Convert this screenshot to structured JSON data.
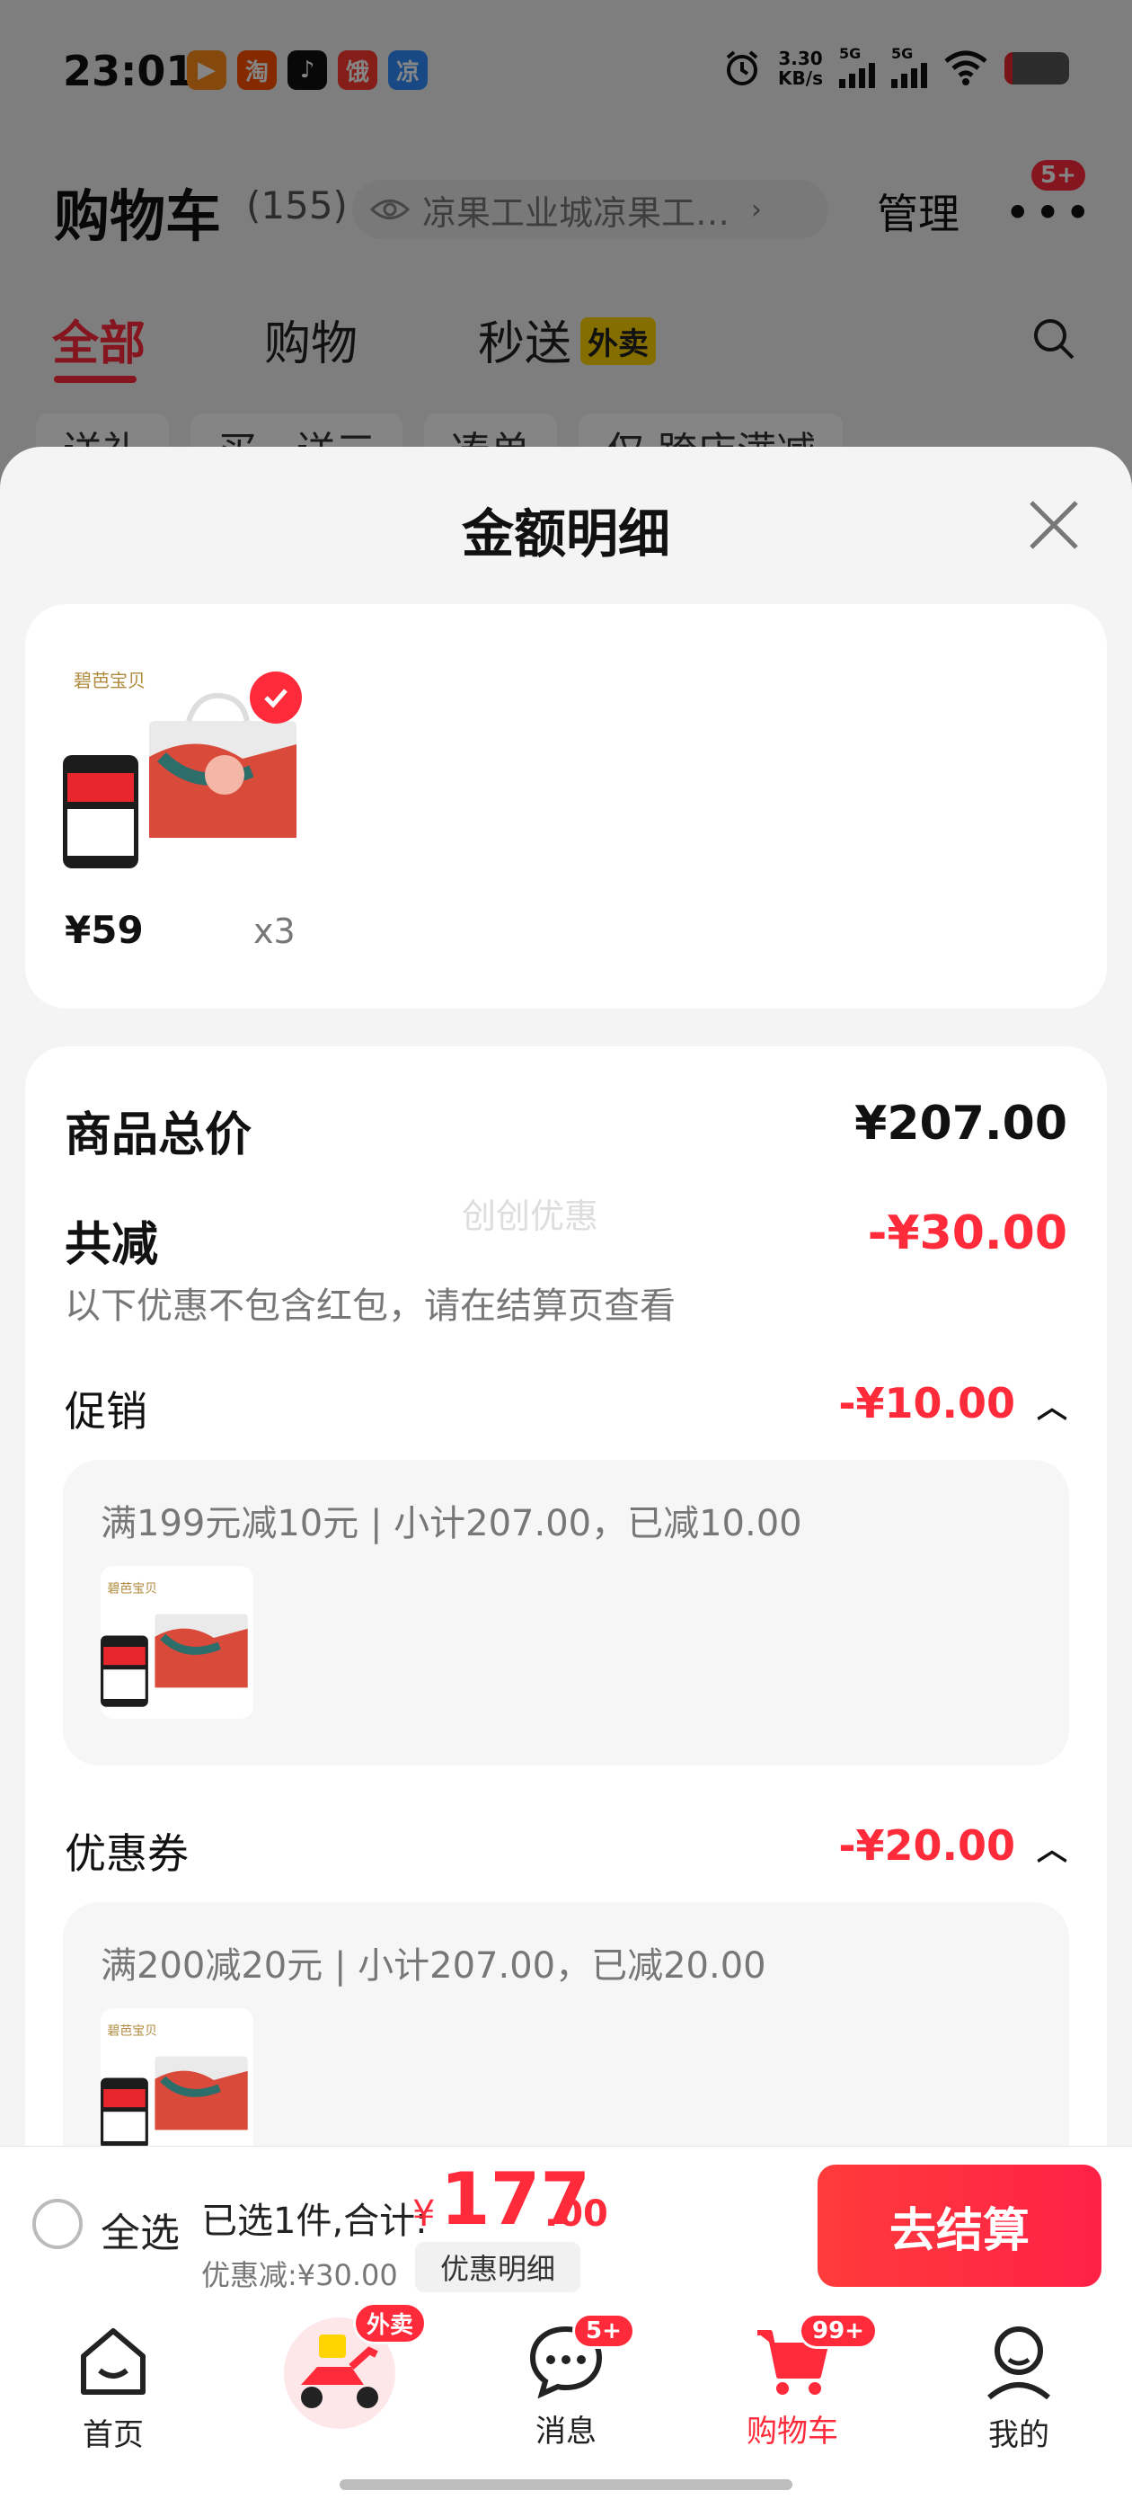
{
  "status_bar": {
    "time": "23:01",
    "apps": [
      {
        "glyph": "▶",
        "color": "#ff8c1a",
        "icon": "video-app-icon"
      },
      {
        "glyph": "淘",
        "color": "#ff5000",
        "icon": "taobao-app-icon"
      },
      {
        "glyph": "♪",
        "color": "#111111",
        "icon": "tiktok-app-icon"
      },
      {
        "glyph": "饿",
        "color": "#ff3b30",
        "icon": "eleme-app-icon"
      },
      {
        "glyph": "凉",
        "color": "#2f8cff",
        "icon": "liangguo-app-icon"
      }
    ],
    "net_speed_value": "3.30",
    "net_speed_unit": "KB/s",
    "network_1": "5G",
    "network_2": "5G",
    "battery_level": 0.12
  },
  "header": {
    "title": "购物车",
    "count": "(155)",
    "address": "凉果工业城凉果工…",
    "manage": "管理",
    "more_badge": "5+"
  },
  "tabs": [
    {
      "label": "全部",
      "active": true
    },
    {
      "label": "购物",
      "active": false
    },
    {
      "label": "秒送",
      "tag": "外卖",
      "active": false
    }
  ],
  "chips": [
    "送礼",
    "买一送三",
    "凑单",
    "仅 跨店满减"
  ],
  "sheet": {
    "title": "金额明细",
    "product": {
      "price": "¥59",
      "qty": "x3"
    },
    "total_label": "商品总价",
    "total_value": "¥207.00",
    "reduce_label": "共减",
    "reduce_value": "-¥30.00",
    "reduce_hint": "以下优惠不包含红包，请在结算页查看",
    "watermark": "创创优惠",
    "promo": {
      "label": "促销",
      "value": "-¥10.00",
      "desc": "满199元减10元 | 小计207.00，已减10.00"
    },
    "coupon": {
      "label": "优惠券",
      "value": "-¥20.00",
      "desc": "满200减20元 | 小计207.00，已减20.00"
    }
  },
  "checkout": {
    "select_all": "全选",
    "summary": "已选1件,合计:",
    "currency": "¥",
    "total_int": "177",
    "total_dec": ".00",
    "discount": "优惠减:¥30.00",
    "discount_detail": "优惠明细",
    "button": "去结算"
  },
  "tab_bar": [
    {
      "label": "首页",
      "icon": "home-icon"
    },
    {
      "label": "",
      "icon": "delivery-scooter-icon",
      "badge": "外卖"
    },
    {
      "label": "消息",
      "icon": "message-icon",
      "badge": "5+"
    },
    {
      "label": "购物车",
      "icon": "cart-icon",
      "badge": "99+",
      "active": true
    },
    {
      "label": "我的",
      "icon": "profile-icon"
    }
  ],
  "colors": {
    "accent": "#ff2a3a",
    "overlay": "rgba(0,0,0,0.48)",
    "card": "#ffffff",
    "sheet_bg": "#f4f4f4"
  }
}
